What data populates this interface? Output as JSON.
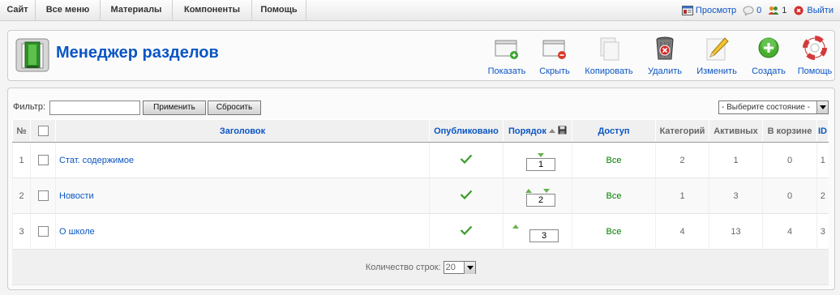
{
  "menu": {
    "items": [
      {
        "label": "Сайт"
      },
      {
        "label": "Все меню"
      },
      {
        "label": "Материалы"
      },
      {
        "label": "Компоненты"
      },
      {
        "label": "Помощь"
      }
    ]
  },
  "status": {
    "preview": "Просмотр",
    "messages": "0",
    "users": "1",
    "logout": "Выйти"
  },
  "page": {
    "title": "Менеджер разделов"
  },
  "toolbar": [
    {
      "label": "Показать",
      "icon": "publish-icon"
    },
    {
      "label": "Скрыть",
      "icon": "unpublish-icon"
    },
    {
      "label": "Копировать",
      "icon": "copy-icon"
    },
    {
      "label": "Удалить",
      "icon": "delete-icon"
    },
    {
      "label": "Изменить",
      "icon": "edit-icon"
    },
    {
      "label": "Создать",
      "icon": "new-icon"
    },
    {
      "label": "Помощь",
      "icon": "help-icon"
    }
  ],
  "filter": {
    "label": "Фильтр:",
    "value": "",
    "apply": "Применить",
    "reset": "Сбросить",
    "state_select": "- Выберите состояние -"
  },
  "table": {
    "headers": {
      "num": "№",
      "title": "Заголовок",
      "published": "Опубликовано",
      "order": "Порядок",
      "access": "Доступ",
      "categories": "Категорий",
      "active": "Активных",
      "trash": "В корзине",
      "id": "ID"
    },
    "rows": [
      {
        "num": "1",
        "title": "Стат. содержимое",
        "order": "1",
        "access": "Все",
        "categories": "2",
        "active": "1",
        "trash": "0",
        "id": "1"
      },
      {
        "num": "2",
        "title": "Новости",
        "order": "2",
        "access": "Все",
        "categories": "1",
        "active": "3",
        "trash": "0",
        "id": "2"
      },
      {
        "num": "3",
        "title": "О школе",
        "order": "3",
        "access": "Все",
        "categories": "4",
        "active": "13",
        "trash": "4",
        "id": "3"
      }
    ],
    "footer": {
      "rows_label": "Количество строк:",
      "rows_value": "20"
    }
  },
  "colors": {
    "link": "#0B55C4",
    "access_green": "#008000",
    "arrow_green": "#66b14b"
  }
}
